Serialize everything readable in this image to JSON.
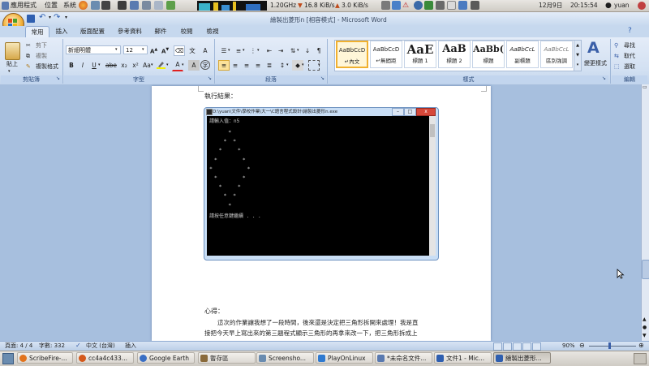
{
  "top_panel": {
    "menus": [
      "應用程式",
      "位置",
      "系統"
    ],
    "cpu_freq": "1.20GHz",
    "net_down": "16.8 KiB/s",
    "net_up": "3.0 KiB/s",
    "date": "12月9日",
    "time": "20:15:54",
    "user": "yuan"
  },
  "window": {
    "title": "繪製出菱形n [相容模式] - Microsoft Word",
    "quick_access": [
      "save",
      "undo",
      "redo"
    ]
  },
  "tabs": [
    "常用",
    "插入",
    "版面配置",
    "參考資料",
    "郵件",
    "校閱",
    "檢視"
  ],
  "active_tab": "常用",
  "ribbon": {
    "clipboard": {
      "label": "剪貼簿",
      "paste": "貼上",
      "cut": "剪下",
      "copy": "複製",
      "format_painter": "複製格式"
    },
    "font": {
      "label": "字型",
      "font_name": "新細明體",
      "font_size": "12",
      "bold": "B",
      "italic": "I",
      "underline": "U",
      "strike": "abe",
      "sub": "x₂",
      "sup": "x²",
      "change_case": "Aa"
    },
    "paragraph": {
      "label": "段落"
    },
    "styles": {
      "label": "樣式",
      "items": [
        {
          "sample": "AaBbCcD",
          "name": "↵內文"
        },
        {
          "sample": "AaBbCcD",
          "name": "↵無間距"
        },
        {
          "sample": "AaE",
          "name": "標題 1"
        },
        {
          "sample": "AaB",
          "name": "標題 2"
        },
        {
          "sample": "AaBb(",
          "name": "標題"
        },
        {
          "sample": "AaBbCcL",
          "name": "副標題"
        },
        {
          "sample": "AaBbCcL",
          "name": "區別強調"
        }
      ],
      "change_styles": "變更樣式"
    },
    "editing": {
      "label": "編輯",
      "find": "尋找",
      "replace": "取代",
      "select": "選取"
    }
  },
  "document": {
    "heading": "執行結果：",
    "console_title": "D:\\yuan\\文件\\學校作業\\大一\\C語言程式設計\\繪製出菱形n.exe",
    "console_prompt": "請輸入值：",
    "console_input": "n5",
    "console_diamond": "    *\n   * *\n  *   *\n *     *\n*       *\n *     *\n  *   *\n   * *\n    *",
    "console_continue": "請按任意鍵繼續 . . .",
    "notes_heading": "心得：",
    "para1": "這次的作業讓我想了一段時間，後來還是決定把三角形拆開來處理！我是直",
    "para2": "接把今天早上寫出來的第三題程式顯示三角形的再拿來改一下，把三角形拆成上"
  },
  "status_bar": {
    "page": "頁面: 4 / 4",
    "words": "字數: 332",
    "language": "中文 (台灣)",
    "mode": "插入",
    "zoom": "90%"
  },
  "taskbar": [
    {
      "label": "ScribeFire-...",
      "color": "#e2731c"
    },
    {
      "label": "cc4a4c433...",
      "color": "#d4581a"
    },
    {
      "label": "Google Earth",
      "color": "#3a6fc4"
    },
    {
      "label": "暫存區",
      "color": "#8a6a3a"
    },
    {
      "label": "Screensho...",
      "color": "#6a8cb0"
    },
    {
      "label": "PlayOnLinux",
      "color": "#2f7ad0"
    },
    {
      "label": "*未命名文件...",
      "color": "#5a7ab0"
    },
    {
      "label": "文件1 - Mic...",
      "color": "#2f5fb0"
    },
    {
      "label": "繪製出菱形...",
      "color": "#2f5fb0"
    }
  ]
}
